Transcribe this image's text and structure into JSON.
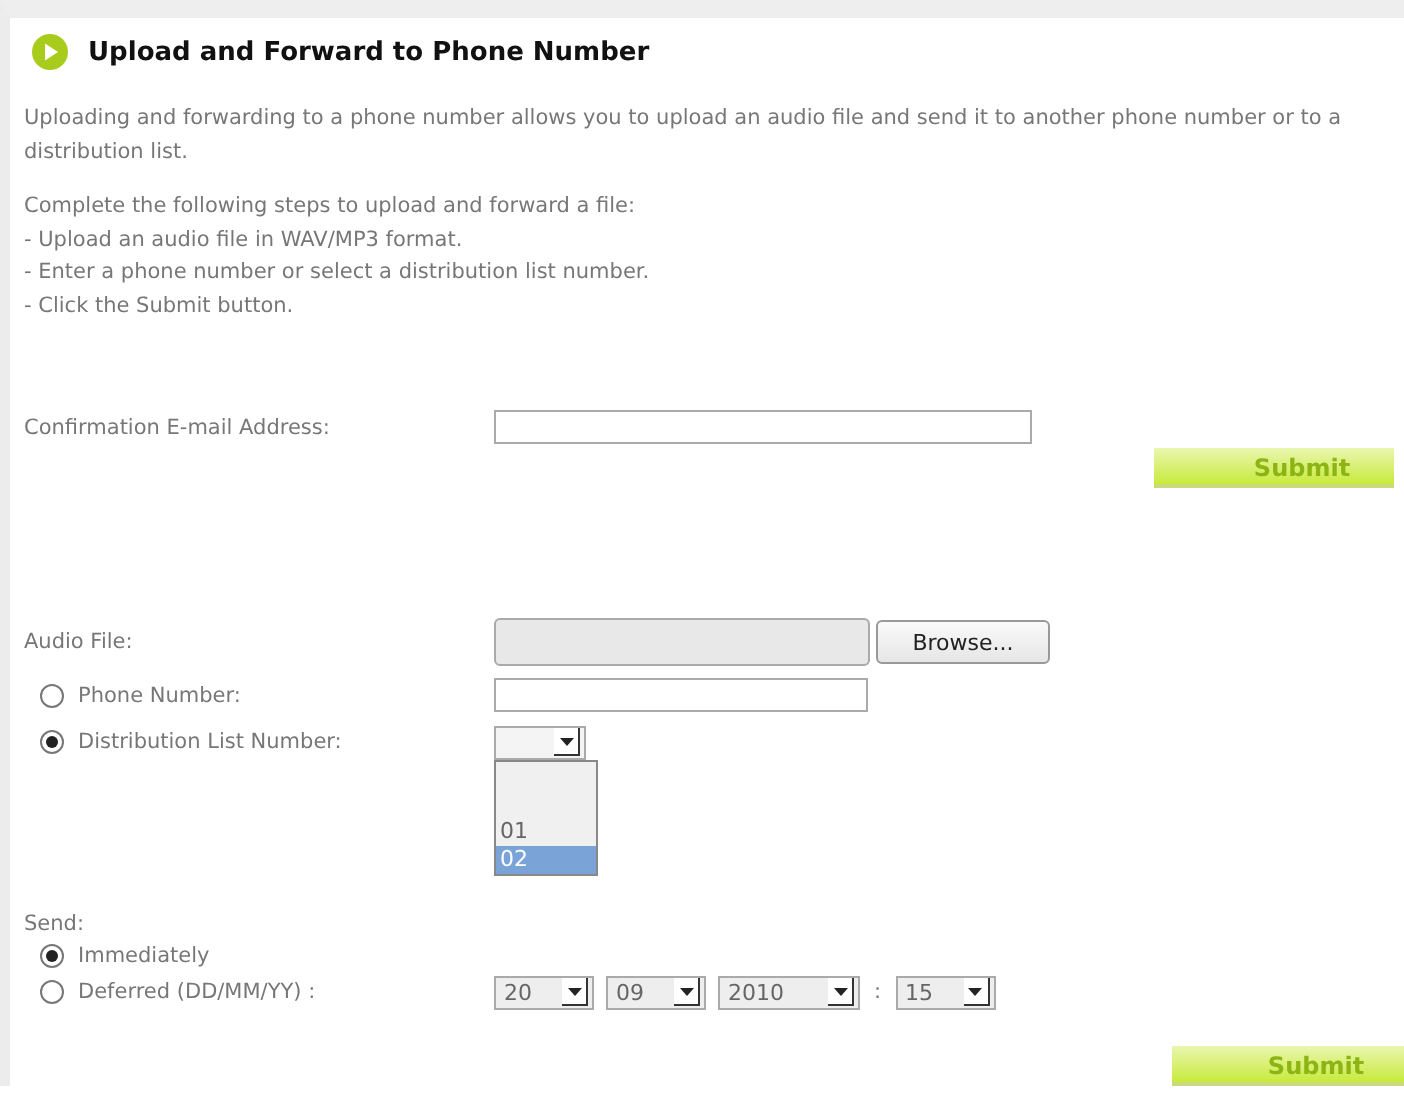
{
  "title": "Upload and Forward to Phone Number",
  "intro": "Uploading and forwarding to a phone number allows you to upload an audio file and send it to another phone number or to a distribution list.",
  "steps_heading": "Complete the following steps to upload and forward a file:",
  "steps": [
    "- Upload an audio file in WAV/MP3 format.",
    "- Enter a phone number or select a distribution list number.",
    "- Click the Submit button."
  ],
  "confirmation": {
    "label": "Confirmation E-mail Address:",
    "submit": "Submit"
  },
  "audio_file": {
    "label": "Audio File:",
    "browse": "Browse..."
  },
  "recipients": [
    {
      "label": "Phone Number:",
      "selected": false,
      "kind": "text"
    },
    {
      "label": "Distribution List Number:",
      "selected": true,
      "kind": "select",
      "dropdown": {
        "expanded": true,
        "options": [
          {
            "label": "01",
            "selected": false
          },
          {
            "label": "02",
            "selected": true
          }
        ]
      }
    }
  ],
  "send": {
    "label": "Send:",
    "options": [
      {
        "label": "Immediately",
        "selected": true
      },
      {
        "label": "Deferred (DD/MM/YY) :",
        "selected": false
      }
    ],
    "date": [
      "20",
      "09",
      "2010"
    ],
    "separator": ":",
    "time": "15"
  },
  "submit": "Submit"
}
